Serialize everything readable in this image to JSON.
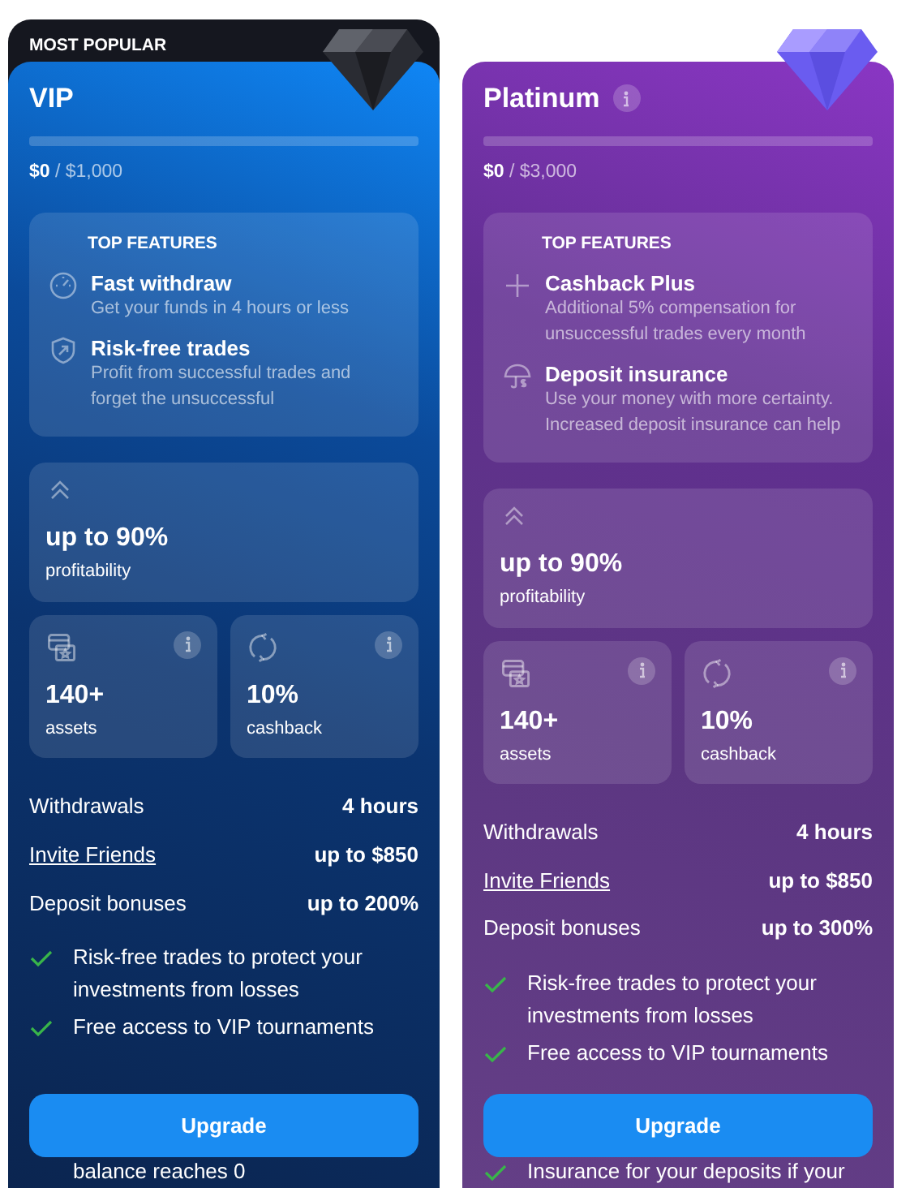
{
  "plans": [
    {
      "kind": "vip",
      "badge": "MOST POPULAR",
      "name": "VIP",
      "name_info": false,
      "progress": {
        "level": 0,
        "text": "**$0** / $1,000"
      },
      "features_title": "TOP FEATURES",
      "features": [
        {
          "title": "Fast withdraw",
          "text": "Get your funds in 4 hours or less"
        },
        {
          "title": "Risk-free trades",
          "text": "Profit from successful trades and forget the unsuccessful"
        }
      ],
      "profit": {
        "value": "up to 90%",
        "label": "profitability"
      },
      "stats": [
        {
          "value": "140+",
          "label": "assets"
        },
        {
          "value": "10%",
          "label": "cashback"
        }
      ],
      "rows": [
        {
          "label": "Withdrawals",
          "value": "4 hours",
          "link": false
        },
        {
          "label": "Invite Friends",
          "value": "up to $850",
          "link": true
        },
        {
          "label": "Deposit bonuses",
          "value": "up to 200%",
          "link": false
        }
      ],
      "perks": [
        {
          "kind": "check",
          "text": "Risk-free trades to protect your investments from losses"
        },
        {
          "kind": "check",
          "text": "Free access to VIP tournaments"
        }
      ],
      "button": "Upgrade",
      "perks_after_button": [
        {
          "kind": "tail",
          "text": "balance reaches 0"
        }
      ]
    },
    {
      "kind": "platinum",
      "name": "Platinum",
      "name_info": true,
      "progress": {
        "level": 0,
        "text": "**$0** / $3,000"
      },
      "features_title": "TOP FEATURES",
      "features": [
        {
          "title": "Cashback Plus",
          "text": "Additional 5% compensation for unsuccessful trades every month"
        },
        {
          "title": "Deposit insurance",
          "text": "Use your money with more certainty. Increased deposit insurance can help"
        }
      ],
      "profit": {
        "value": "up to 90%",
        "label": "profitability"
      },
      "stats": [
        {
          "value": "140+",
          "label": "assets"
        },
        {
          "value": "10%",
          "label": "cashback"
        }
      ],
      "rows": [
        {
          "label": "Withdrawals",
          "value": "4 hours",
          "link": false
        },
        {
          "label": "Invite Friends",
          "value": "up to $850",
          "link": true
        },
        {
          "label": "Deposit bonuses",
          "value": "up to 300%",
          "link": false
        }
      ],
      "perks": [
        {
          "kind": "check",
          "text": "Risk-free trades to protect your investments from losses"
        },
        {
          "kind": "check",
          "text": "Free access to VIP tournaments"
        }
      ],
      "button": "Upgrade",
      "perks_after_button": [
        {
          "kind": "check",
          "text": "Insurance for your deposits if your"
        }
      ]
    }
  ]
}
